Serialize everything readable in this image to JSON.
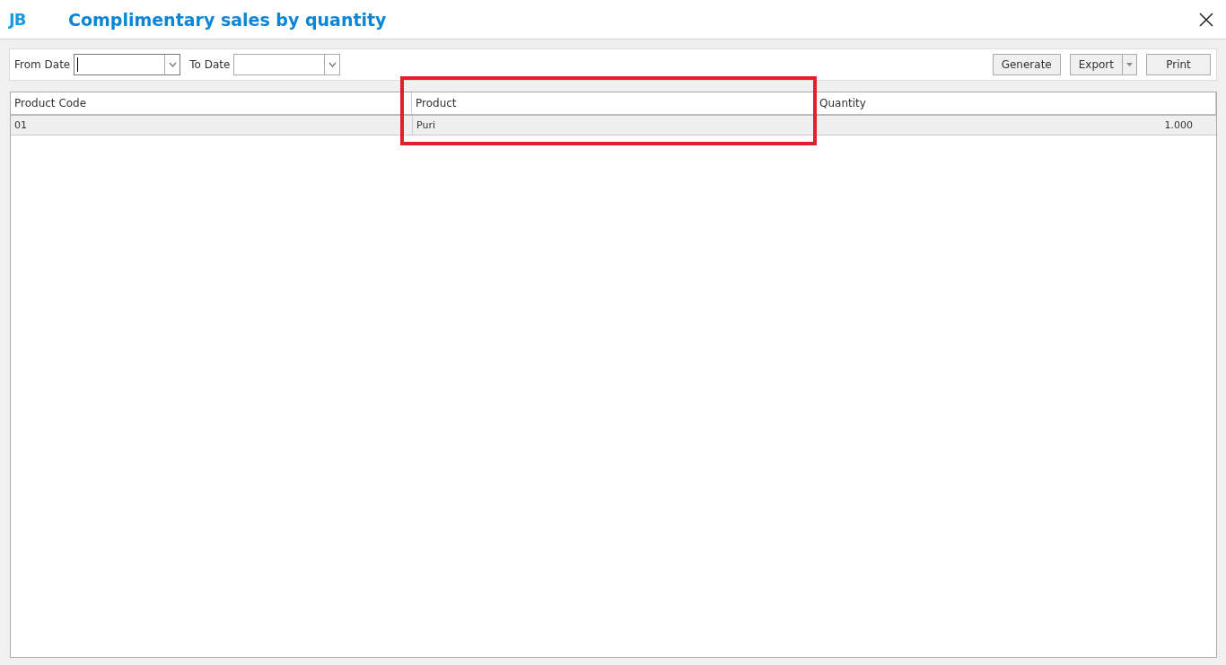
{
  "window": {
    "title": "Complimentary sales by quantity",
    "logo": "JB"
  },
  "filters": [
    {
      "label": "From Date",
      "focused": true
    },
    {
      "label": "To Date",
      "focused": false
    }
  ],
  "buttons": [
    {
      "label": "Generate",
      "kind": "plain"
    },
    {
      "label": "Export",
      "kind": "split"
    },
    {
      "label": "Print",
      "kind": "plain"
    }
  ],
  "table": {
    "columns": [
      "Product Code",
      "Product",
      "Quantity"
    ],
    "rows": [
      {
        "cells": [
          "01",
          "Puri",
          "1.000"
        ],
        "selected": true
      }
    ]
  }
}
